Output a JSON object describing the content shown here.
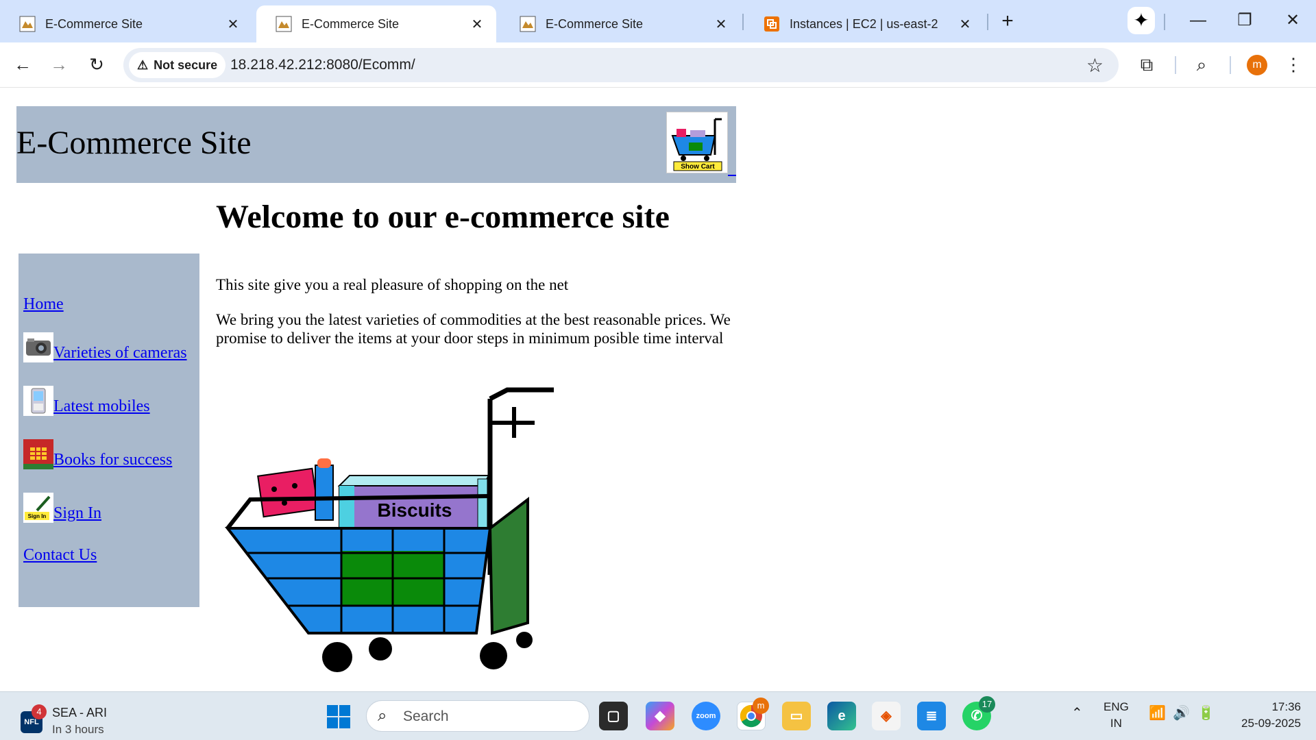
{
  "browser": {
    "tabs": [
      {
        "title": "E-Commerce Site",
        "active": false
      },
      {
        "title": "E-Commerce Site",
        "active": true
      },
      {
        "title": "E-Commerce Site",
        "active": false
      },
      {
        "title": "Instances | EC2 | us-east-2",
        "active": false
      }
    ],
    "new_tab": "+",
    "security_label": "Not secure",
    "url": "18.218.42.212:8080/Ecomm/",
    "profile_initial": "m"
  },
  "page": {
    "site_title": "E-Commerce Site",
    "cart_button_label": "Show Cart",
    "heading": "Welcome to our e-commerce site",
    "nav": [
      {
        "label": "Home",
        "icon": "none"
      },
      {
        "label": "Varieties of cameras",
        "icon": "camera-icon"
      },
      {
        "label": " Latest mobiles",
        "icon": "mobile-phone-icon"
      },
      {
        "label": "Books for success",
        "icon": "books-icon"
      },
      {
        "label": "Sign In",
        "icon": "sign-in-icon"
      },
      {
        "label": "Contact Us",
        "icon": "none"
      }
    ],
    "paragraphs": [
      "This site give you a real pleasure of shopping on the net",
      "We bring you the latest varieties of commodities at the best reasonable prices. We promise to deliver the items at your door steps in minimum posible time interval"
    ],
    "cart_image_label": "Biscuits"
  },
  "taskbar": {
    "weather_badge": "4",
    "weather_line1": "SEA - ARI",
    "weather_line2": "In 3 hours",
    "search_placeholder": "Search",
    "chrome_badge": "m",
    "whatsapp_badge": "17",
    "lang_line1": "ENG",
    "lang_line2": "IN",
    "time": "17:36",
    "date": "25-09-2025"
  },
  "colors": {
    "tabstrip": "#d3e3fd",
    "site_panel": "#a9b9cc",
    "link": "#0000ee",
    "taskbar": "#dfe8f0"
  }
}
